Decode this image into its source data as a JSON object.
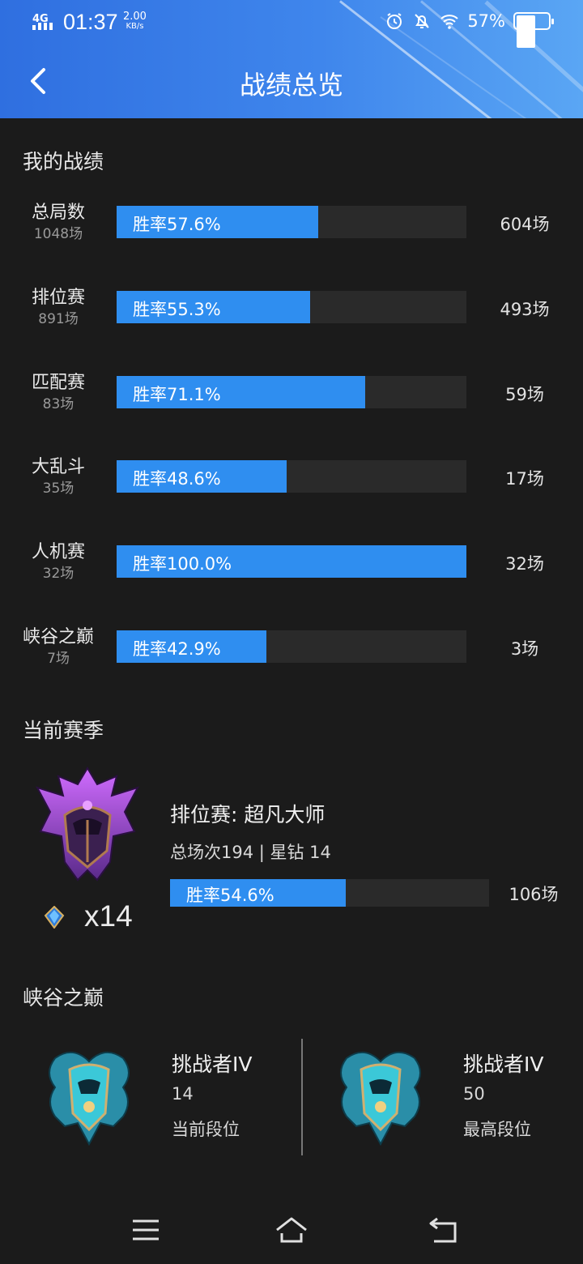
{
  "status_bar": {
    "network": "4G",
    "time": "01:37",
    "net_speed": "2.00",
    "net_speed_unit": "KB/s",
    "battery": "57%"
  },
  "header": {
    "title": "战绩总览"
  },
  "my_stats": {
    "title": "我的战绩",
    "rows": [
      {
        "name": "总局数",
        "games": "1048场",
        "rate_label": "胜率57.6%",
        "rate": 57.6,
        "count": "604场"
      },
      {
        "name": "排位赛",
        "games": "891场",
        "rate_label": "胜率55.3%",
        "rate": 55.3,
        "count": "493场"
      },
      {
        "name": "匹配赛",
        "games": "83场",
        "rate_label": "胜率71.1%",
        "rate": 71.1,
        "count": "59场"
      },
      {
        "name": "大乱斗",
        "games": "35场",
        "rate_label": "胜率48.6%",
        "rate": 48.6,
        "count": "17场"
      },
      {
        "name": "人机赛",
        "games": "32场",
        "rate_label": "胜率100.0%",
        "rate": 100.0,
        "count": "32场"
      },
      {
        "name": "峡谷之巅",
        "games": "7场",
        "rate_label": "胜率42.9%",
        "rate": 42.9,
        "count": "3场"
      }
    ]
  },
  "season": {
    "title": "当前赛季",
    "rank_title": "排位赛: 超凡大师",
    "info": "总场次194 | 星钻 14",
    "rate_label": "胜率54.6%",
    "rate": 54.6,
    "count": "106场",
    "stars": "x14"
  },
  "peak": {
    "title": "峡谷之巅",
    "current": {
      "rank": "挑战者IV",
      "value": "14",
      "label": "当前段位"
    },
    "highest": {
      "rank": "挑战者IV",
      "value": "50",
      "label": "最高段位"
    }
  },
  "colors": {
    "accent": "#2f8ef0",
    "header": "#3a80e8",
    "background": "#1b1b1b"
  }
}
